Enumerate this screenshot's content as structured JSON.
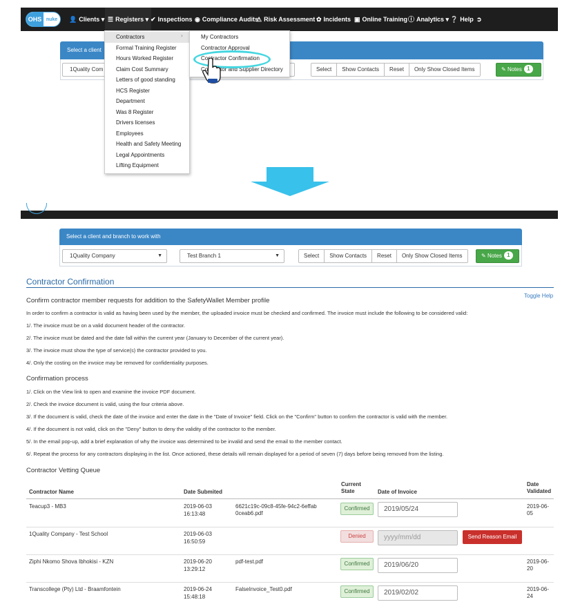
{
  "nav": {
    "logo_left": "OHS",
    "logo_right": "nuke",
    "items": [
      {
        "label": "Clients",
        "icon": "user-icon",
        "caret": true
      },
      {
        "label": "Registers",
        "icon": "list-icon",
        "caret": true
      },
      {
        "label": "Inspections",
        "icon": "check-icon"
      },
      {
        "label": "Compliance Audits",
        "icon": "eye-icon"
      },
      {
        "label": "Risk Assessment",
        "icon": "warning-icon"
      },
      {
        "label": "Incidents",
        "icon": "flame-icon"
      },
      {
        "label": "Online Training",
        "icon": "book-icon"
      },
      {
        "label": "Analytics",
        "icon": "info-icon",
        "caret": true
      },
      {
        "label": "Help",
        "icon": "question-icon"
      }
    ],
    "logout_icon": "logout-icon"
  },
  "top_panel": {
    "heading": "Select a client",
    "client_value": "1Quality Com",
    "buttons": [
      "Select",
      "Show Contacts",
      "Reset",
      "Only Show Closed Items"
    ],
    "notes_label": "Notes",
    "notes_count": "1"
  },
  "registers_menu": [
    "Contractors",
    "Formal Training Register",
    "Hours Worked Register",
    "Claim Cost Summary",
    "Letters of good standing",
    "HCS Register",
    "Department",
    "Was 8 Register",
    "Drivers licenses",
    "Employees",
    "Health and Safety Meeting",
    "Legal Appointments",
    "Lifting Equipment"
  ],
  "contractors_submenu": [
    "My Contractors",
    "Contractor Approval",
    "Contractor Confirmation",
    "Contractor and Supplier Directory"
  ],
  "panel2": {
    "heading": "Select a client and branch to work with",
    "client_value": "1Quality Company",
    "branch_value": "Test Branch 1",
    "buttons": [
      "Select",
      "Show Contacts",
      "Reset",
      "Only Show Closed Items"
    ],
    "notes_label": "Notes",
    "notes_count": "1"
  },
  "page": {
    "title": "Contractor Confirmation",
    "toggle_help": "Toggle Help",
    "intro_heading": "Confirm contractor member requests for addition to the SafetyWallet Member profile",
    "intro_text": "In order to confirm a contractor is valid as having been used by the member, the uploaded invoice must be checked and confirmed. The invoice must include the following to be considered valid:",
    "criteria": [
      "1/. The invoice must be on a valid document header of the contractor.",
      "2/. The invoice must be dated and the date fall within the current year (January to December of the current year).",
      "3/. The invoice must show the type of service(s) the contractor provided to you.",
      "4/. Only the costing on the invoice may be removed for confidentiality purposes."
    ],
    "process_heading": "Confirmation process",
    "process": [
      "1/. Click on the View link to open and examine the invoice PDF document.",
      "2/. Check the invoice document is valid, using the four criteria above.",
      "3/. If the document is valid, check the date of the invoice and enter the date in the \"Date of Invoice\" field. Click on the \"Confirm\" button to confirm the contractor is valid with the member.",
      "4/. If the document is not valid, click on the \"Deny\" button to deny the validity of the contractor to the member.",
      "5/. In the email pop-up, add a brief explanation of why the invoice was determined to be invalid and send the email to the member contact.",
      "6/. Repeat the process for any contractors displaying in the list. Once actioned, these details will remain displayed for a period of seven (7) days before being removed from the listing."
    ],
    "queue_heading": "Contractor Vetting Queue"
  },
  "table": {
    "headers": {
      "name": "Contractor Name",
      "submitted": "Date Submited",
      "state": "Current State",
      "invoice_date": "Date of Invoice",
      "validated": "Date Validated"
    },
    "rows": [
      {
        "name": "Teacup3 - MB3",
        "date": "2019-06-03",
        "time": "16:13:48",
        "file": "6621c19c-09c8-45fe-94c2-6effab0ceab6.pdf",
        "state": "Confirmed",
        "invoice": "2019/05/24",
        "validated": "2019-06-05"
      },
      {
        "name": "1Quality Company - Test School",
        "date": "2019-06-03",
        "time": "16:50:59",
        "file": "",
        "state": "Denied",
        "invoice": "",
        "invoice_placeholder": "yyyy/mm/dd",
        "action": "Send Reason Email",
        "validated": ""
      },
      {
        "name": "Ziphi Nkomo Shova Ibhokisi - KZN",
        "date": "2019-06-20",
        "time": "13:29:12",
        "file": "pdf-test.pdf",
        "state": "Confirmed",
        "invoice": "2019/06/20",
        "validated": "2019-06-20"
      },
      {
        "name": "Transcollege (Pty) Ltd - Braamfontein",
        "date": "2019-06-24",
        "time": "15:48:18",
        "file": "FalseInvoice_Test0.pdf",
        "state": "Confirmed",
        "invoice": "2019/02/02",
        "validated": "2019-06-24"
      }
    ]
  },
  "colors": {
    "nav_bg": "#1e1e1e",
    "panel_head": "#3b87c6",
    "notes_green": "#48a748",
    "title_blue": "#2b6aa6",
    "highlight": "#45d6e0",
    "deny_red": "#c9302c"
  }
}
